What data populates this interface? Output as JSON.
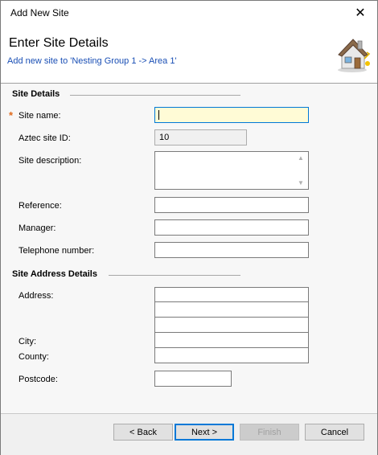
{
  "window": {
    "title": "Add New Site",
    "close_glyph": "✕"
  },
  "header": {
    "title": "Enter Site Details",
    "subtitle": "Add new site to 'Nesting Group 1 -> Area 1'",
    "icon": "house-icon"
  },
  "site_details": {
    "heading": "Site Details",
    "required_marker": "*",
    "fields": {
      "site_name": {
        "label": "Site name:",
        "value": ""
      },
      "aztec_id": {
        "label": "Aztec site ID:",
        "value": "10"
      },
      "description": {
        "label": "Site description:",
        "value": ""
      },
      "reference": {
        "label": "Reference:",
        "value": ""
      },
      "manager": {
        "label": "Manager:",
        "value": ""
      },
      "telephone": {
        "label": "Telephone number:",
        "value": ""
      }
    }
  },
  "address_details": {
    "heading": "Site Address Details",
    "fields": {
      "address": {
        "label": "Address:",
        "lines": [
          "",
          "",
          ""
        ]
      },
      "city": {
        "label": "City:",
        "value": ""
      },
      "county": {
        "label": "County:",
        "value": ""
      },
      "postcode": {
        "label": "Postcode:",
        "value": ""
      }
    }
  },
  "buttons": {
    "back": "< Back",
    "next": "Next >",
    "finish": "Finish",
    "cancel": "Cancel"
  },
  "colors": {
    "subtitle": "#1a4fb5",
    "required": "#e06a1c",
    "focus_fill": "#fffbd6",
    "focus_border": "#0078d7"
  }
}
